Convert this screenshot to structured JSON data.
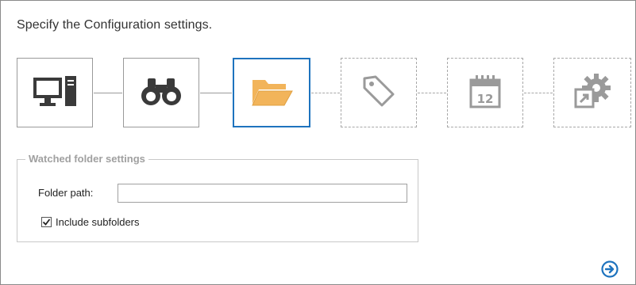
{
  "page": {
    "title": "Specify the Configuration settings."
  },
  "wizard": {
    "steps": [
      {
        "icon": "computer-icon",
        "state": "done"
      },
      {
        "icon": "binoculars-icon",
        "state": "done"
      },
      {
        "icon": "folder-open-icon",
        "state": "active"
      },
      {
        "icon": "tag-icon",
        "state": "todo"
      },
      {
        "icon": "calendar-icon",
        "state": "todo",
        "calendar_day": "12"
      },
      {
        "icon": "gear-shortcut-icon",
        "state": "todo"
      }
    ]
  },
  "watched_folder": {
    "legend": "Watched folder settings",
    "folder_path_label": "Folder path:",
    "folder_path_value": "",
    "include_subfolders_label": "Include subfolders",
    "include_subfolders_checked": true
  },
  "navigation": {
    "next_icon": "arrow-right-circle-icon"
  },
  "colors": {
    "accent": "#1e73be",
    "folder": "#f2b45a",
    "icon_dark": "#3a3a3a",
    "icon_disabled": "#9a9a9a"
  }
}
